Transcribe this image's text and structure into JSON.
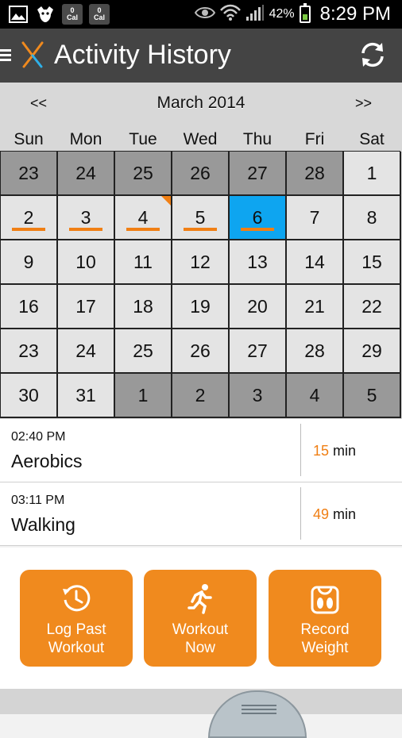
{
  "status_bar": {
    "icons": [
      "gallery-icon",
      "bird-notification-icon",
      "calorie-badge-icon",
      "calorie-badge-icon",
      "eye-icon",
      "wifi-icon",
      "signal-icon",
      "battery-icon"
    ],
    "cal_badge_1": {
      "top": "0",
      "bottom": "Cal"
    },
    "cal_badge_2": {
      "top": "0",
      "bottom": "Cal"
    },
    "battery": "42%",
    "time": "8:29 PM"
  },
  "app_bar": {
    "title": "Activity History",
    "menu_icon": "hamburger-icon",
    "logo_icon": "app-logo-icon",
    "refresh_icon": "refresh-icon"
  },
  "calendar": {
    "prev_label": "<<",
    "next_label": ">>",
    "month_label": "March 2014",
    "weekdays": [
      "Sun",
      "Mon",
      "Tue",
      "Wed",
      "Thu",
      "Fri",
      "Sat"
    ],
    "days": [
      {
        "label": "23",
        "muted": true
      },
      {
        "label": "24",
        "muted": true
      },
      {
        "label": "25",
        "muted": true
      },
      {
        "label": "26",
        "muted": true
      },
      {
        "label": "27",
        "muted": true
      },
      {
        "label": "28",
        "muted": true
      },
      {
        "label": "1"
      },
      {
        "label": "2",
        "activity": true
      },
      {
        "label": "3",
        "activity": true
      },
      {
        "label": "4",
        "activity": true,
        "corner": true
      },
      {
        "label": "5",
        "activity": true
      },
      {
        "label": "6",
        "activity": true,
        "selected": true
      },
      {
        "label": "7"
      },
      {
        "label": "8"
      },
      {
        "label": "9"
      },
      {
        "label": "10"
      },
      {
        "label": "11"
      },
      {
        "label": "12"
      },
      {
        "label": "13"
      },
      {
        "label": "14"
      },
      {
        "label": "15"
      },
      {
        "label": "16"
      },
      {
        "label": "17"
      },
      {
        "label": "18"
      },
      {
        "label": "19"
      },
      {
        "label": "20"
      },
      {
        "label": "21"
      },
      {
        "label": "22"
      },
      {
        "label": "23"
      },
      {
        "label": "24"
      },
      {
        "label": "25"
      },
      {
        "label": "26"
      },
      {
        "label": "27"
      },
      {
        "label": "28"
      },
      {
        "label": "29"
      },
      {
        "label": "30"
      },
      {
        "label": "31"
      },
      {
        "label": "1",
        "muted": true
      },
      {
        "label": "2",
        "muted": true
      },
      {
        "label": "3",
        "muted": true
      },
      {
        "label": "4",
        "muted": true
      },
      {
        "label": "5",
        "muted": true
      }
    ],
    "colors": {
      "accent": "#f07f14",
      "selected": "#0ea5f0",
      "muted": "#999999",
      "cell": "#e4e4e4"
    }
  },
  "workouts": [
    {
      "time": "02:40 PM",
      "name": "Aerobics",
      "duration": "15",
      "unit": "min"
    },
    {
      "time": "03:11 PM",
      "name": "Walking",
      "duration": "49",
      "unit": "min"
    }
  ],
  "actions": [
    {
      "line1": "Log Past",
      "line2": "Workout",
      "icon": "history-clock-icon"
    },
    {
      "line1": "Workout",
      "line2": "Now",
      "icon": "running-person-icon"
    },
    {
      "line1": "Record",
      "line2": "Weight",
      "icon": "scale-icon"
    }
  ]
}
